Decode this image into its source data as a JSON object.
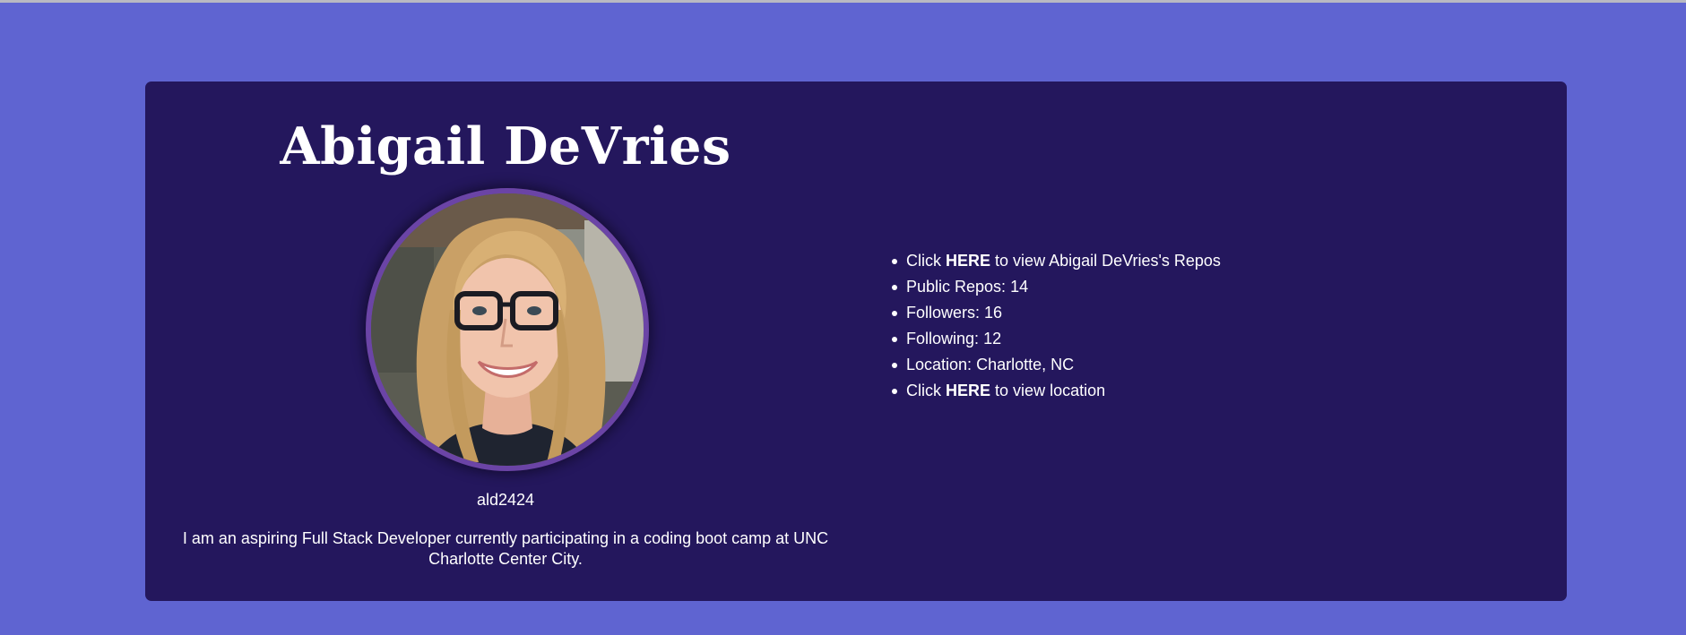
{
  "profile": {
    "name": "Abigail DeVries",
    "username": "ald2424",
    "bio": "I am an aspiring Full Stack Developer currently participating in a coding boot camp at UNC Charlotte Center City."
  },
  "info": {
    "repos_prefix": "Click",
    "repos_link": "HERE",
    "repos_suffix": "to view Abigail DeVries's Repos",
    "public_repos_label": "Public Repos:",
    "public_repos": "14",
    "followers_label": "Followers:",
    "followers": "16",
    "following_label": "Following:",
    "following": "12",
    "location_label": "Location:",
    "location": "Charlotte, NC",
    "location_prefix": "Click",
    "location_link": "HERE",
    "location_suffix": "to view location"
  },
  "colors": {
    "page_background": "#5f64d1",
    "card_background": "#24175d",
    "avatar_border": "#6b44a6",
    "text": "#ffffff"
  }
}
